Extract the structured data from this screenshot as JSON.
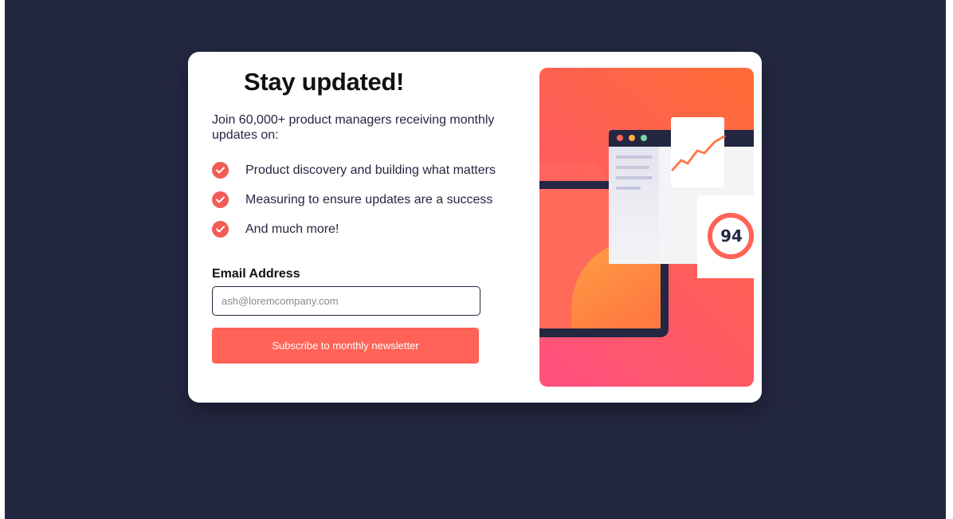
{
  "card": {
    "title": "Stay updated!",
    "intro": "Join 60,000+ product managers receiving monthly updates on:",
    "features": [
      "Product discovery and building what matters",
      "Measuring to ensure updates are a success",
      "And much more!"
    ]
  },
  "form": {
    "email_label": "Email Address",
    "email_placeholder": "ash@loremcompany.com",
    "email_value": "",
    "subscribe_label": "Subscribe to monthly newsletter"
  },
  "illustration": {
    "score": "94",
    "gradient_top": "#ff6a3a",
    "gradient_bottom": "#ff527b"
  },
  "colors": {
    "page_background": "#242742",
    "accent": "#ff6257",
    "check": "#f25c54",
    "text": "#242742"
  },
  "icons": {
    "feature_check": "check-circle-icon"
  }
}
